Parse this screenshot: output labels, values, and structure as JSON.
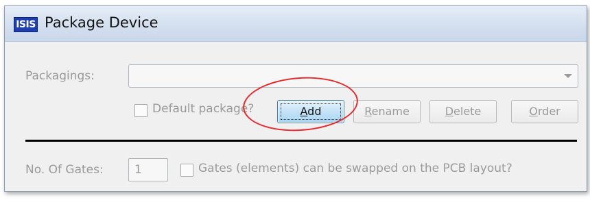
{
  "window": {
    "title": "Package Device",
    "app_icon_text": "ISIS"
  },
  "packagings": {
    "label": "Packagings:",
    "selected": ""
  },
  "default_package": {
    "label": "Default package?",
    "checked": false
  },
  "buttons": {
    "add": {
      "mnemonic": "A",
      "rest": "dd",
      "enabled": true,
      "focused": true
    },
    "rename": {
      "mnemonic": "R",
      "rest": "ename",
      "enabled": false
    },
    "delete": {
      "mnemonic": "D",
      "rest": "elete",
      "enabled": false
    },
    "order": {
      "mnemonic": "O",
      "rest": "rder",
      "enabled": false
    }
  },
  "gates": {
    "label": "No. Of Gates:",
    "value": "1",
    "swap_label": "Gates (elements) can be swapped on the PCB layout?",
    "swap_checked": false
  },
  "annotation": {
    "color": "#e8282a",
    "target": "add-button"
  }
}
